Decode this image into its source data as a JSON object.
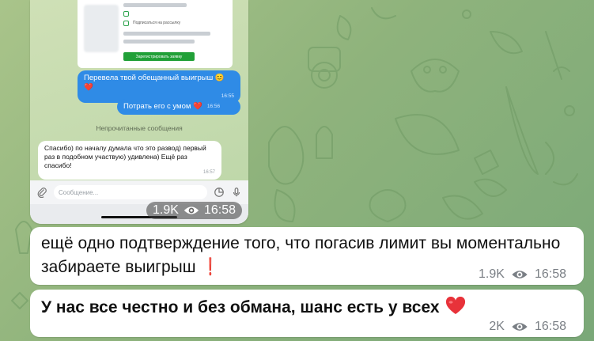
{
  "photo_message": {
    "screenshot": {
      "card_rows": [
        "",
        "Подписаться на рассылку"
      ],
      "card_button": "Зарегистрировать заявку",
      "outgoing_1": {
        "text": "Перевела твой обещанный выигрыш 😊 ❤️",
        "time": "16:55"
      },
      "outgoing_2": {
        "text": "Потрать его с умом ❤️",
        "time": "16:56"
      },
      "unread_label": "Непрочитанные сообщения",
      "incoming": {
        "text": "Спасибо) по началу думала что это развод) первый раз в подобном участвую) удивлена) Ещё раз спасибо!",
        "time": "16:57"
      },
      "input_placeholder": "Сообщение..."
    },
    "views": "1.9K",
    "time": "16:58"
  },
  "messages": [
    {
      "text": "ещё одно подтверждение того, что погасив лимит вы моментально забираете выигрыш",
      "emoji": "❗",
      "views": "1.9K",
      "time": "16:58"
    },
    {
      "text": "У нас все честно и без обмана, шанс есть у всех",
      "emoji": "❤️",
      "views": "2K",
      "time": "16:58"
    }
  ],
  "colors": {
    "wallpaper": "#8fb37c",
    "bubble": "#ffffff",
    "outgoing_blue": "#2f8be6",
    "meta_gray": "#7a7f85",
    "accent_red": "#d8232a"
  }
}
